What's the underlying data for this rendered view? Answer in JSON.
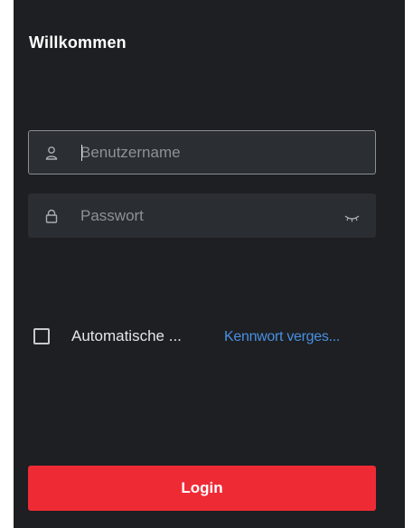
{
  "header": {
    "title": "Willkommen"
  },
  "username": {
    "placeholder": "Benutzername",
    "icon": "user-icon"
  },
  "password": {
    "placeholder": "Passwort",
    "icon": "lock-icon",
    "toggle_icon": "eye-closed-icon"
  },
  "remember": {
    "label": "Automatische ...",
    "checked": false
  },
  "forgot": {
    "label": "Kennwort verges..."
  },
  "login": {
    "label": "Login"
  },
  "colors": {
    "panel": "#1d1f22",
    "accent": "#ee2b35",
    "link": "#4a90e2"
  }
}
